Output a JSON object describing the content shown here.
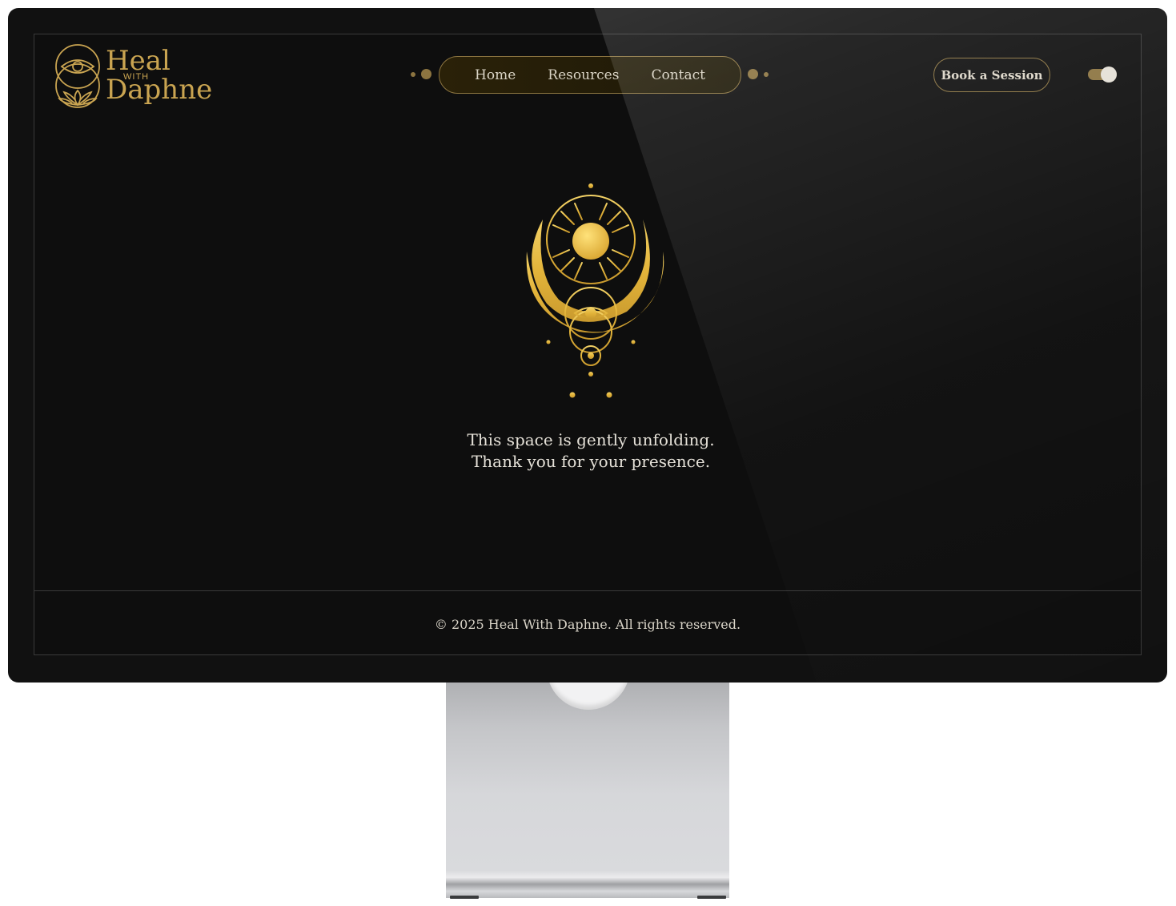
{
  "brand": {
    "line1": "Heal",
    "line2": "WITH",
    "line3": "Daphne"
  },
  "nav": {
    "items": [
      {
        "label": "Home"
      },
      {
        "label": "Resources"
      },
      {
        "label": "Contact"
      }
    ]
  },
  "header": {
    "cta_label": "Book a Session",
    "theme_toggle": "on"
  },
  "main": {
    "message_line1": "This space is gently unfolding.",
    "message_line2": "Thank you for your presence.",
    "emblem_icon": "sun-moon-eye-emblem-icon"
  },
  "footer": {
    "copyright": "© 2025 Heal With Daphne. All rights reserved."
  },
  "colors": {
    "accent_gold": "#c9a451",
    "background": "#0e0e0e",
    "text": "#e5e1d8",
    "border": "#8b7440"
  }
}
